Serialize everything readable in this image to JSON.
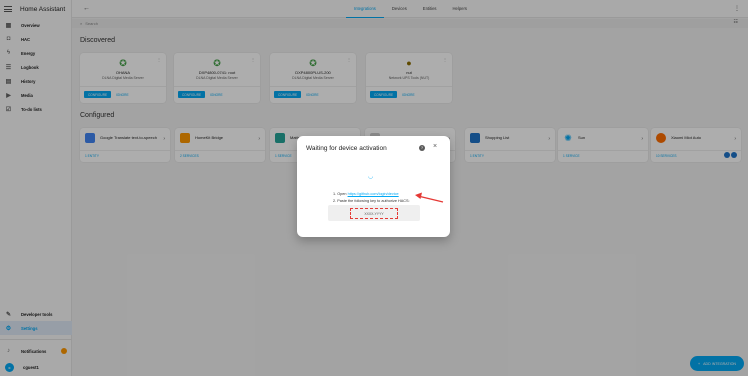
{
  "app": {
    "title": "Home Assistant"
  },
  "sidebar": {
    "items": [
      {
        "label": "Overview",
        "icon": "grid-icon"
      },
      {
        "label": "HAC",
        "icon": "shield-icon"
      },
      {
        "label": "Energy",
        "icon": "lightning-icon"
      },
      {
        "label": "Logbook",
        "icon": "list-icon"
      },
      {
        "label": "History",
        "icon": "chart-icon"
      },
      {
        "label": "Media",
        "icon": "play-icon"
      },
      {
        "label": "To-do lists",
        "icon": "checklist-icon"
      }
    ],
    "bottom": {
      "developer_tools": "Developer tools",
      "settings": "Settings",
      "notifications": "Notifications",
      "user": "cguest1"
    }
  },
  "header": {
    "tabs": [
      {
        "label": "Integrations",
        "active": true
      },
      {
        "label": "Devices",
        "active": false
      },
      {
        "label": "Entities",
        "active": false
      },
      {
        "label": "Helpers",
        "active": false
      }
    ]
  },
  "search": {
    "placeholder": "Search"
  },
  "discovered": {
    "title": "Discovered",
    "configure_label": "CONFIGURE",
    "ignore_label": "IGNORE",
    "cards": [
      {
        "name": "OHANA",
        "subtitle": "DLNA Digital Media Server",
        "icon": "dlna-icon"
      },
      {
        "name": "DXP4800-0741: root",
        "subtitle": "DLNA Digital Media Server",
        "icon": "dlna-icon"
      },
      {
        "name": "DXP4800PLUS-200",
        "subtitle": "DLNA Digital Media Server",
        "icon": "dlna-icon"
      },
      {
        "name": "nut",
        "subtitle": "Network UPS Tools (NUT)",
        "icon": "nut-icon"
      }
    ]
  },
  "configured": {
    "title": "Configured",
    "cards": [
      {
        "name": "Google Translate text-to-speech",
        "link": "1 ENTITY",
        "color": "#4285f4"
      },
      {
        "name": "HomeKit Bridge",
        "link": "2 SERVICES",
        "color": "#ff9800"
      },
      {
        "name": "Matter (BETA)",
        "link": "1 SERVICE",
        "color": "#26a69a"
      },
      {
        "name": "",
        "link": "",
        "color": "#cccccc"
      },
      {
        "name": "Shopping List",
        "link": "1 ENTITY",
        "color": "#1e73c9"
      },
      {
        "name": "Sun",
        "link": "1 SERVICE",
        "color": "#03a9f4"
      },
      {
        "name": "Xiaomi Miot Auto",
        "link": "10 SERVICES",
        "color": "#ff6d00"
      }
    ]
  },
  "dialog": {
    "title": "Waiting for device activation",
    "step1_prefix": "1. Open",
    "step1_link": "https://github.com/login/device",
    "step2": "2. Paste the following key to authorize HACS:",
    "code": "XXXX-YYYY"
  },
  "fab": {
    "label": "ADD INTEGRATION"
  },
  "colors": {
    "accent": "#03a9f4",
    "annotation": "#e53935"
  }
}
